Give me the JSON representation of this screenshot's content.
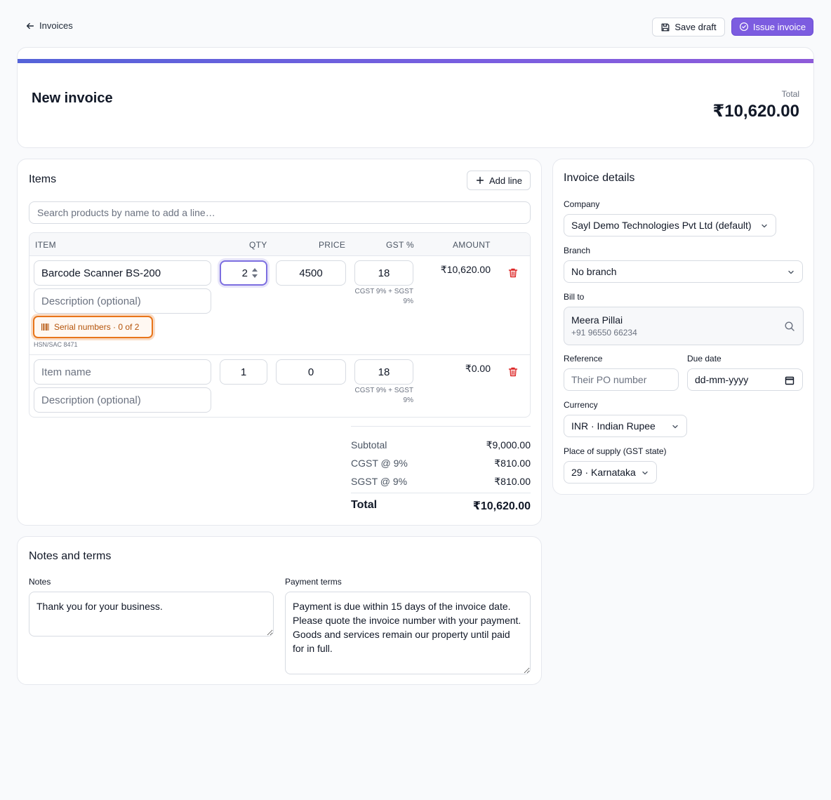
{
  "topbar": {
    "back_label": "Invoices",
    "save_draft_label": "Save draft",
    "issue_invoice_label": "Issue invoice"
  },
  "header": {
    "title": "New invoice",
    "total_label": "Total",
    "total_value": "₹10,620.00"
  },
  "colors": {
    "accent": "#7c5ce0",
    "gradient_start": "#5563d9",
    "gradient_end": "#8e5bd9",
    "serial_highlight": "#e8751a",
    "delete_red": "#dc2626"
  },
  "items": {
    "title": "Items",
    "add_line_label": "Add line",
    "search_placeholder": "Search products by name to add a line…",
    "columns": [
      "ITEM",
      "QTY",
      "PRICE",
      "GST %",
      "AMOUNT"
    ],
    "lines": [
      {
        "name": "Barcode Scanner BS-200",
        "name_placeholder": "Item name",
        "description_placeholder": "Description (optional)",
        "qty": "2",
        "price": "4500",
        "gst": "18",
        "gst_note": "CGST 9% + SGST 9%",
        "amount": "₹10,620.00",
        "serial_label": "Serial numbers · 0 of 2",
        "hsn": "HSN/SAC 8471"
      },
      {
        "name": "",
        "name_placeholder": "Item name",
        "description_placeholder": "Description (optional)",
        "qty": "1",
        "price": "0",
        "gst": "18",
        "gst_note": "CGST 9% + SGST 9%",
        "amount": "₹0.00"
      }
    ],
    "totals": {
      "subtotal_label": "Subtotal",
      "subtotal_value": "₹9,000.00",
      "cgst_label": "CGST @ 9%",
      "cgst_value": "₹810.00",
      "sgst_label": "SGST @ 9%",
      "sgst_value": "₹810.00",
      "total_label": "Total",
      "total_value": "₹10,620.00"
    }
  },
  "notes": {
    "title": "Notes and terms",
    "notes_label": "Notes",
    "notes_value": "Thank you for your business.",
    "terms_label": "Payment terms",
    "terms_value": "Payment is due within 15 days of the invoice date. Please quote the invoice number with your payment.\nGoods and services remain our property until paid for in full."
  },
  "details": {
    "title": "Invoice details",
    "company_label": "Company",
    "company_value": "Sayl Demo Technologies Pvt Ltd (default)",
    "branch_label": "Branch",
    "branch_value": "No branch",
    "billto_label": "Bill to",
    "billto_name": "Meera Pillai",
    "billto_phone": "+91 96550 66234",
    "reference_label": "Reference",
    "reference_placeholder": "Their PO number",
    "due_date_label": "Due date",
    "due_date_placeholder": "dd-mm-yyyy",
    "currency_label": "Currency",
    "currency_value": "INR · Indian Rupee",
    "supply_label": "Place of supply (GST state)",
    "supply_value": "29 · Karnataka"
  }
}
